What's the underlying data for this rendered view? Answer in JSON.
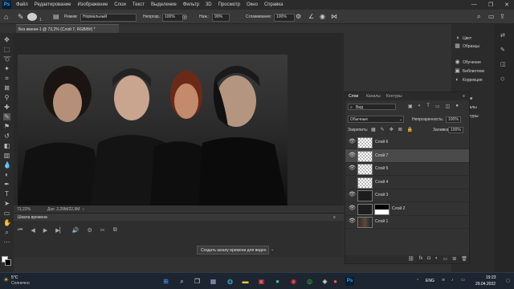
{
  "app": {
    "logo": "Ps"
  },
  "menubar": {
    "items": [
      "Файл",
      "Редактирование",
      "Изображение",
      "Слои",
      "Текст",
      "Выделение",
      "Фильтр",
      "3D",
      "Просмотр",
      "Окно",
      "Справка"
    ],
    "window_controls": [
      "—",
      "❐",
      "✕"
    ]
  },
  "options": {
    "mode_label": "Режим:",
    "mode_value": "Нормальный",
    "opacity_label": "Непрозр.:",
    "opacity_value": "100%",
    "pressure_label": "Наж.:",
    "pressure_value": "90%",
    "smoothing_label": "Сглаживание:",
    "smoothing_value": "100%",
    "brush_size": "1"
  },
  "document": {
    "tab_title": "Без имени-1 @ 73,2% (Слой 7, RGB/8#) *",
    "zoom": "73,22%",
    "doc_info": "Док: 2,29М/22,9М"
  },
  "timeline": {
    "title": "Шкала времени",
    "create_button": "Создать шкалу времени для видео"
  },
  "right_panels": {
    "group1": [
      {
        "icon": "color-icon",
        "label": "Цвет"
      },
      {
        "icon": "swatches-icon",
        "label": "Образцы"
      }
    ],
    "group2": [
      {
        "icon": "learn-icon",
        "label": "Обучение"
      },
      {
        "icon": "libraries-icon",
        "label": "Библиотеки"
      },
      {
        "icon": "adjustments-icon",
        "label": "Коррекция"
      }
    ],
    "group3": [
      {
        "icon": "layers-icon",
        "label": "Слои"
      },
      {
        "icon": "channels-icon",
        "label": "Каналы"
      },
      {
        "icon": "paths-icon",
        "label": "Контуры"
      }
    ]
  },
  "layers_panel": {
    "tabs": [
      "Слои",
      "Каналы",
      "Контуры"
    ],
    "filter_label": "Вид",
    "blend_mode": "Обычные",
    "opacity_label": "Непрозрачность:",
    "opacity_value": "100%",
    "lock_label": "Закрепить:",
    "fill_label": "Заливка:",
    "fill_value": "100%",
    "layers": [
      {
        "name": "Слой 6",
        "visible": true,
        "selected": false,
        "thumb": "transparent"
      },
      {
        "name": "Слой 7",
        "visible": true,
        "selected": true,
        "thumb": "transparent"
      },
      {
        "name": "Слой 5",
        "visible": true,
        "selected": false,
        "thumb": "transparent"
      },
      {
        "name": "Слой 4",
        "visible": false,
        "selected": false,
        "thumb": "transparent"
      },
      {
        "name": "Слой 3",
        "visible": true,
        "selected": false,
        "thumb": "dark"
      },
      {
        "name": "Слой 2",
        "visible": true,
        "selected": false,
        "thumb": "dark"
      },
      {
        "name": "Слой 1",
        "visible": true,
        "selected": false,
        "thumb": "photo"
      }
    ],
    "footer_icons": [
      "link-icon",
      "fx-icon",
      "mask-icon",
      "adjustment-layer-icon",
      "group-icon",
      "new-layer-icon",
      "trash-icon"
    ]
  },
  "taskbar": {
    "weather_temp": "5°C",
    "weather_desc": "Солнечно",
    "lang": "ENG",
    "time": "19:23",
    "date": "29.04.2022"
  },
  "colors": {
    "accent": "#31a8ff",
    "panel": "#323232",
    "selected_row": "#4a4a4a"
  }
}
